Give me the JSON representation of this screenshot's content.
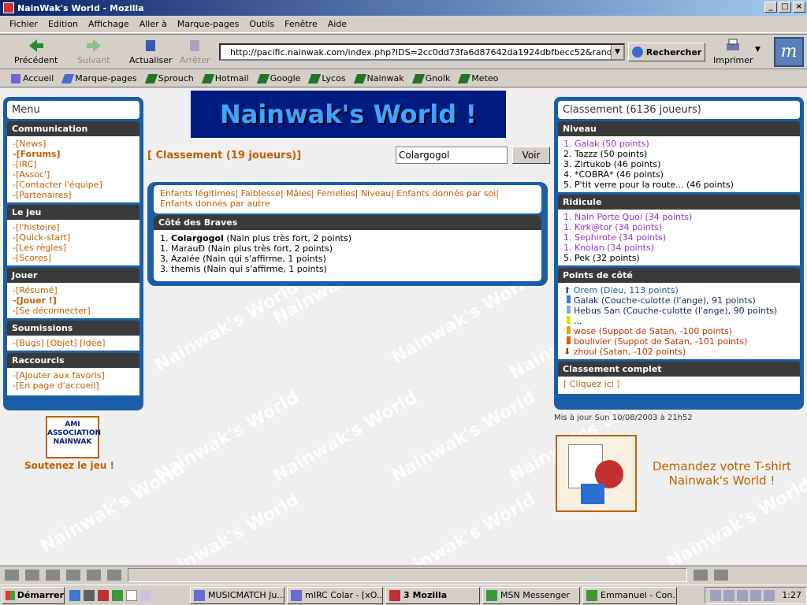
{
  "window": {
    "title": "NainWak's World - Mozilla"
  },
  "menu": [
    "Fichier",
    "Edition",
    "Affichage",
    "Aller à",
    "Marque-pages",
    "Outils",
    "Fenêtre",
    "Aide"
  ],
  "nav": {
    "back": "Précédent",
    "forward": "Suivant",
    "reload": "Actualiser",
    "stop": "Arrêter",
    "search": "Rechercher",
    "print": "Imprimer"
  },
  "url": "http://pacific.nainwak.com/index.php?IDS=2cc0dd73fa6d87642da1924dbfbecc52&randid=8d549",
  "bookmarks": [
    "Accueil",
    "Marque-pages",
    "Sprouch",
    "Hotmail",
    "Google",
    "Lycos",
    "Nainwak",
    "Gnolk",
    "Meteo"
  ],
  "left": {
    "title": "Menu",
    "sections": [
      {
        "head": "Communication",
        "items": [
          "-[News]",
          "-[Forums]",
          "-[IRC]",
          "-[Assoc']",
          "-[Contacter l'équipe]",
          "-[Partenaires]"
        ]
      },
      {
        "head": "Le jeu",
        "items": [
          "-[l'histoire]",
          "-[Quick-start]",
          "-[Les règles]",
          "-[Scores]"
        ]
      },
      {
        "head": "Jouer",
        "items": [
          "-[Résumé]",
          "-[Jouer !]",
          "-[Se déconnecter]"
        ]
      },
      {
        "head": "Soumissions",
        "items": [
          "-[Bugs] [Objet] [Idée]"
        ]
      },
      {
        "head": "Raccourcis",
        "items": [
          "-[Ajouter aux favoris]",
          "-[En page d'accueil]"
        ]
      }
    ],
    "assoc_logo_text": "AMI ASSOCIATION NAINWAK",
    "support": "Soutenez le jeu !"
  },
  "center": {
    "banner": "Nainwak's World !",
    "classement": "[ Classement (19 joueurs)]",
    "search_value": "Colargogol",
    "search_button": "Voir",
    "tab_links_line1": "Enfants légitimes| Faiblesse| Mâles| Femelles| Niveau| Enfants donnés par soi|",
    "tab_links_line2": "Enfants donnés par autre",
    "brave_head": "Côté des Braves",
    "brave_list": [
      {
        "rank": "1.",
        "name": "Colargogol",
        "rest": " (Nain plus très fort, 2 points)"
      },
      {
        "rank": "1.",
        "name": "",
        "rest": "MarauÐ (Nain plus très fort, 2 points)"
      },
      {
        "rank": "3.",
        "name": "",
        "rest": "Azalée (Nain qui s'affirme, 1 points)"
      },
      {
        "rank": "3.",
        "name": "",
        "rest": "themis (Nain qui s'affirme, 1 points)"
      }
    ]
  },
  "right": {
    "title": "Classement (6136 joueurs)",
    "niveau_head": "Niveau",
    "niveau": [
      {
        "text": "1. Galak (50 points)",
        "color": "purple"
      },
      {
        "text": "2. Tazzz (50 points)",
        "color": "black"
      },
      {
        "text": "3. Zirtukob (46 points)",
        "color": "black"
      },
      {
        "text": "4. *COBRA* (46 points)",
        "color": "black"
      },
      {
        "text": "5. P'tit verre pour la route... (46 points)",
        "color": "black"
      }
    ],
    "ridicule_head": "Ridicule",
    "ridicule": [
      {
        "text": "1. Nain Porte Quoi (34 points)",
        "color": "purple"
      },
      {
        "text": "1. Kirk@tor (34 points)",
        "color": "purple"
      },
      {
        "text": "1. Sephirote (34 points)",
        "color": "purple"
      },
      {
        "text": "1. Knolan (34 points)",
        "color": "purple"
      },
      {
        "text": "5. Pek (32 points)",
        "color": "black"
      }
    ],
    "cote_head": "Points de côté",
    "cote": [
      {
        "text": "Orem (Dieu, 113 points)",
        "color": "blue",
        "marker": "#1a5ea8"
      },
      {
        "text": "Galak (Couche-culotte (l'ange), 91 points)",
        "color": "navy",
        "marker": "#3a7ad0"
      },
      {
        "text": "Hebus San (Couche-culotte (l'ange), 90 points)",
        "color": "navy",
        "marker": "#7ab0e0"
      },
      {
        "text": "...",
        "color": "black",
        "marker": "#e0e000"
      },
      {
        "text": "wose (Suppot de Satan, -100 points)",
        "color": "red",
        "marker": "#f0a000"
      },
      {
        "text": "boulivier (Suppot de Satan, -101 points)",
        "color": "red",
        "marker": "#e06000"
      },
      {
        "text": "zhoul (Satan, -102 points)",
        "color": "red",
        "marker": "#c03000"
      }
    ],
    "complet_head": "Classement complet",
    "complet_link": "[ Cliquez ici ]",
    "updated": "Mis à jour Sun 10/08/2003 à 21h52",
    "tshirt_line1": "Demandez votre T-shirt",
    "tshirt_line2": "Nainwak's World !"
  },
  "watermark": "Nainwak's World",
  "taskbar": {
    "start": "Démarrer",
    "tasks": [
      "MUSICMATCH Ju...",
      "mIRC Colar - [xO...",
      "3 Mozilla",
      "MSN Messenger",
      "Emmanuel - Con..."
    ],
    "clock": "1:27"
  }
}
